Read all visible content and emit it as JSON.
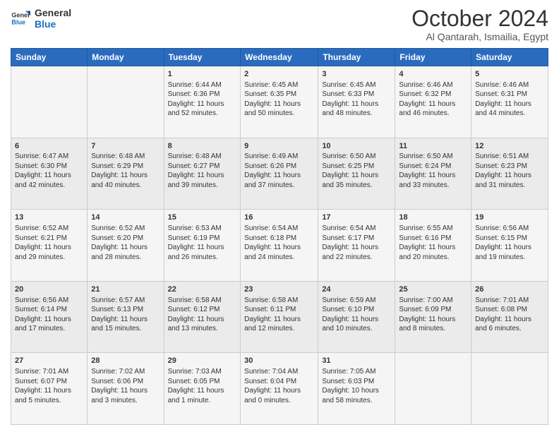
{
  "header": {
    "logo_line1": "General",
    "logo_line2": "Blue",
    "month_title": "October 2024",
    "location": "Al Qantarah, Ismailia, Egypt"
  },
  "weekdays": [
    "Sunday",
    "Monday",
    "Tuesday",
    "Wednesday",
    "Thursday",
    "Friday",
    "Saturday"
  ],
  "weeks": [
    [
      {
        "day": "",
        "info": ""
      },
      {
        "day": "",
        "info": ""
      },
      {
        "day": "1",
        "info": "Sunrise: 6:44 AM\nSunset: 6:36 PM\nDaylight: 11 hours and 52 minutes."
      },
      {
        "day": "2",
        "info": "Sunrise: 6:45 AM\nSunset: 6:35 PM\nDaylight: 11 hours and 50 minutes."
      },
      {
        "day": "3",
        "info": "Sunrise: 6:45 AM\nSunset: 6:33 PM\nDaylight: 11 hours and 48 minutes."
      },
      {
        "day": "4",
        "info": "Sunrise: 6:46 AM\nSunset: 6:32 PM\nDaylight: 11 hours and 46 minutes."
      },
      {
        "day": "5",
        "info": "Sunrise: 6:46 AM\nSunset: 6:31 PM\nDaylight: 11 hours and 44 minutes."
      }
    ],
    [
      {
        "day": "6",
        "info": "Sunrise: 6:47 AM\nSunset: 6:30 PM\nDaylight: 11 hours and 42 minutes."
      },
      {
        "day": "7",
        "info": "Sunrise: 6:48 AM\nSunset: 6:29 PM\nDaylight: 11 hours and 40 minutes."
      },
      {
        "day": "8",
        "info": "Sunrise: 6:48 AM\nSunset: 6:27 PM\nDaylight: 11 hours and 39 minutes."
      },
      {
        "day": "9",
        "info": "Sunrise: 6:49 AM\nSunset: 6:26 PM\nDaylight: 11 hours and 37 minutes."
      },
      {
        "day": "10",
        "info": "Sunrise: 6:50 AM\nSunset: 6:25 PM\nDaylight: 11 hours and 35 minutes."
      },
      {
        "day": "11",
        "info": "Sunrise: 6:50 AM\nSunset: 6:24 PM\nDaylight: 11 hours and 33 minutes."
      },
      {
        "day": "12",
        "info": "Sunrise: 6:51 AM\nSunset: 6:23 PM\nDaylight: 11 hours and 31 minutes."
      }
    ],
    [
      {
        "day": "13",
        "info": "Sunrise: 6:52 AM\nSunset: 6:21 PM\nDaylight: 11 hours and 29 minutes."
      },
      {
        "day": "14",
        "info": "Sunrise: 6:52 AM\nSunset: 6:20 PM\nDaylight: 11 hours and 28 minutes."
      },
      {
        "day": "15",
        "info": "Sunrise: 6:53 AM\nSunset: 6:19 PM\nDaylight: 11 hours and 26 minutes."
      },
      {
        "day": "16",
        "info": "Sunrise: 6:54 AM\nSunset: 6:18 PM\nDaylight: 11 hours and 24 minutes."
      },
      {
        "day": "17",
        "info": "Sunrise: 6:54 AM\nSunset: 6:17 PM\nDaylight: 11 hours and 22 minutes."
      },
      {
        "day": "18",
        "info": "Sunrise: 6:55 AM\nSunset: 6:16 PM\nDaylight: 11 hours and 20 minutes."
      },
      {
        "day": "19",
        "info": "Sunrise: 6:56 AM\nSunset: 6:15 PM\nDaylight: 11 hours and 19 minutes."
      }
    ],
    [
      {
        "day": "20",
        "info": "Sunrise: 6:56 AM\nSunset: 6:14 PM\nDaylight: 11 hours and 17 minutes."
      },
      {
        "day": "21",
        "info": "Sunrise: 6:57 AM\nSunset: 6:13 PM\nDaylight: 11 hours and 15 minutes."
      },
      {
        "day": "22",
        "info": "Sunrise: 6:58 AM\nSunset: 6:12 PM\nDaylight: 11 hours and 13 minutes."
      },
      {
        "day": "23",
        "info": "Sunrise: 6:58 AM\nSunset: 6:11 PM\nDaylight: 11 hours and 12 minutes."
      },
      {
        "day": "24",
        "info": "Sunrise: 6:59 AM\nSunset: 6:10 PM\nDaylight: 11 hours and 10 minutes."
      },
      {
        "day": "25",
        "info": "Sunrise: 7:00 AM\nSunset: 6:09 PM\nDaylight: 11 hours and 8 minutes."
      },
      {
        "day": "26",
        "info": "Sunrise: 7:01 AM\nSunset: 6:08 PM\nDaylight: 11 hours and 6 minutes."
      }
    ],
    [
      {
        "day": "27",
        "info": "Sunrise: 7:01 AM\nSunset: 6:07 PM\nDaylight: 11 hours and 5 minutes."
      },
      {
        "day": "28",
        "info": "Sunrise: 7:02 AM\nSunset: 6:06 PM\nDaylight: 11 hours and 3 minutes."
      },
      {
        "day": "29",
        "info": "Sunrise: 7:03 AM\nSunset: 6:05 PM\nDaylight: 11 hours and 1 minute."
      },
      {
        "day": "30",
        "info": "Sunrise: 7:04 AM\nSunset: 6:04 PM\nDaylight: 11 hours and 0 minutes."
      },
      {
        "day": "31",
        "info": "Sunrise: 7:05 AM\nSunset: 6:03 PM\nDaylight: 10 hours and 58 minutes."
      },
      {
        "day": "",
        "info": ""
      },
      {
        "day": "",
        "info": ""
      }
    ]
  ]
}
